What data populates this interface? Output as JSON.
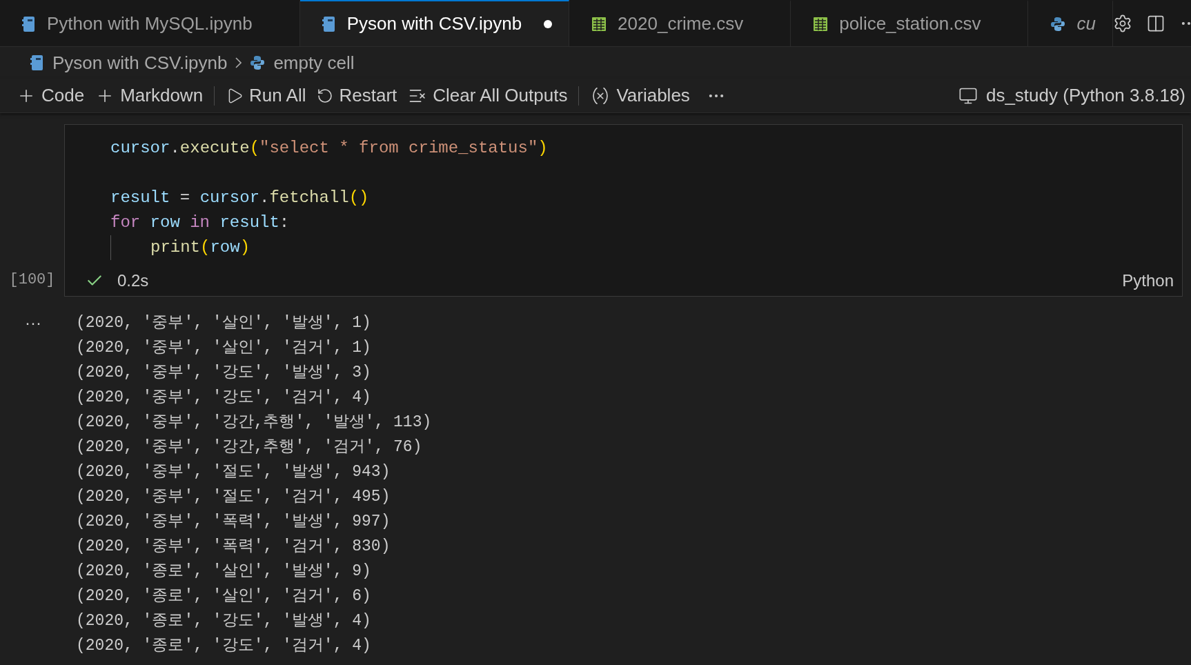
{
  "tabs": [
    {
      "label": "Python with MySQL.ipynb",
      "kind": "notebook",
      "selected": false,
      "dirty": false
    },
    {
      "label": "Pyson with CSV.ipynb",
      "kind": "notebook",
      "selected": true,
      "dirty": true
    },
    {
      "label": "2020_crime.csv",
      "kind": "table",
      "selected": false,
      "dirty": false
    },
    {
      "label": "police_station.csv",
      "kind": "table",
      "selected": false,
      "dirty": false
    },
    {
      "label": "cu",
      "kind": "python",
      "selected": false,
      "dirty": false
    }
  ],
  "breadcrumb": [
    {
      "label": "Pyson with CSV.ipynb",
      "kind": "notebook"
    },
    {
      "label": "empty cell",
      "kind": "python"
    }
  ],
  "toolbar": {
    "items": [
      {
        "kind": "add",
        "label": "Code"
      },
      {
        "kind": "add",
        "label": "Markdown"
      },
      {
        "kind": "separator"
      },
      {
        "kind": "run-all",
        "label": "Run All"
      },
      {
        "kind": "restart",
        "label": "Restart"
      },
      {
        "kind": "clear",
        "label": "Clear All Outputs"
      },
      {
        "kind": "separator"
      },
      {
        "kind": "variables",
        "label": "Variables"
      }
    ],
    "kernel": "ds_study (Python 3.8.18)"
  },
  "cell": {
    "code": [
      {
        "indent": false,
        "tokens": [
          {
            "kind": "variable",
            "text": "cursor"
          },
          {
            "kind": "punct",
            "text": "."
          },
          {
            "kind": "function",
            "text": "execute"
          },
          {
            "kind": "bracket",
            "text": "("
          },
          {
            "kind": "string",
            "text": "\"select * from crime_status\""
          },
          {
            "kind": "bracket",
            "text": ")"
          }
        ]
      },
      {
        "indent": false
      },
      {
        "indent": false,
        "tokens": [
          {
            "kind": "variable",
            "text": "result"
          },
          {
            "kind": "punct",
            "text": " = "
          },
          {
            "kind": "variable",
            "text": "cursor"
          },
          {
            "kind": "punct",
            "text": "."
          },
          {
            "kind": "function",
            "text": "fetchall"
          },
          {
            "kind": "bracket",
            "text": "()"
          }
        ]
      },
      {
        "indent": false,
        "tokens": [
          {
            "kind": "keyword",
            "text": "for "
          },
          {
            "kind": "variable",
            "text": "row "
          },
          {
            "kind": "keyword",
            "text": "in "
          },
          {
            "kind": "variable",
            "text": "result"
          },
          {
            "kind": "punct",
            "text": ":"
          }
        ]
      },
      {
        "indent": true,
        "tokens": [
          {
            "kind": "function",
            "text": "print"
          },
          {
            "kind": "bracket",
            "text": "("
          },
          {
            "kind": "variable",
            "text": "row"
          },
          {
            "kind": "bracket",
            "text": ")"
          }
        ]
      }
    ],
    "execution_count": "[100]",
    "succeeded": true,
    "duration": "0.2s",
    "language": "Python"
  },
  "output": {
    "marker": "···",
    "lines": [
      "(2020, '중부', '살인', '발생', 1)",
      "(2020, '중부', '살인', '검거', 1)",
      "(2020, '중부', '강도', '발생', 3)",
      "(2020, '중부', '강도', '검거', 4)",
      "(2020, '중부', '강간,추행', '발생', 113)",
      "(2020, '중부', '강간,추행', '검거', 76)",
      "(2020, '중부', '절도', '발생', 943)",
      "(2020, '중부', '절도', '검거', 495)",
      "(2020, '중부', '폭력', '발생', 997)",
      "(2020, '중부', '폭력', '검거', 830)",
      "(2020, '종로', '살인', '발생', 9)",
      "(2020, '종로', '살인', '검거', 6)",
      "(2020, '종로', '강도', '발생', 4)",
      "(2020, '종로', '강도', '검거', 4)"
    ]
  }
}
